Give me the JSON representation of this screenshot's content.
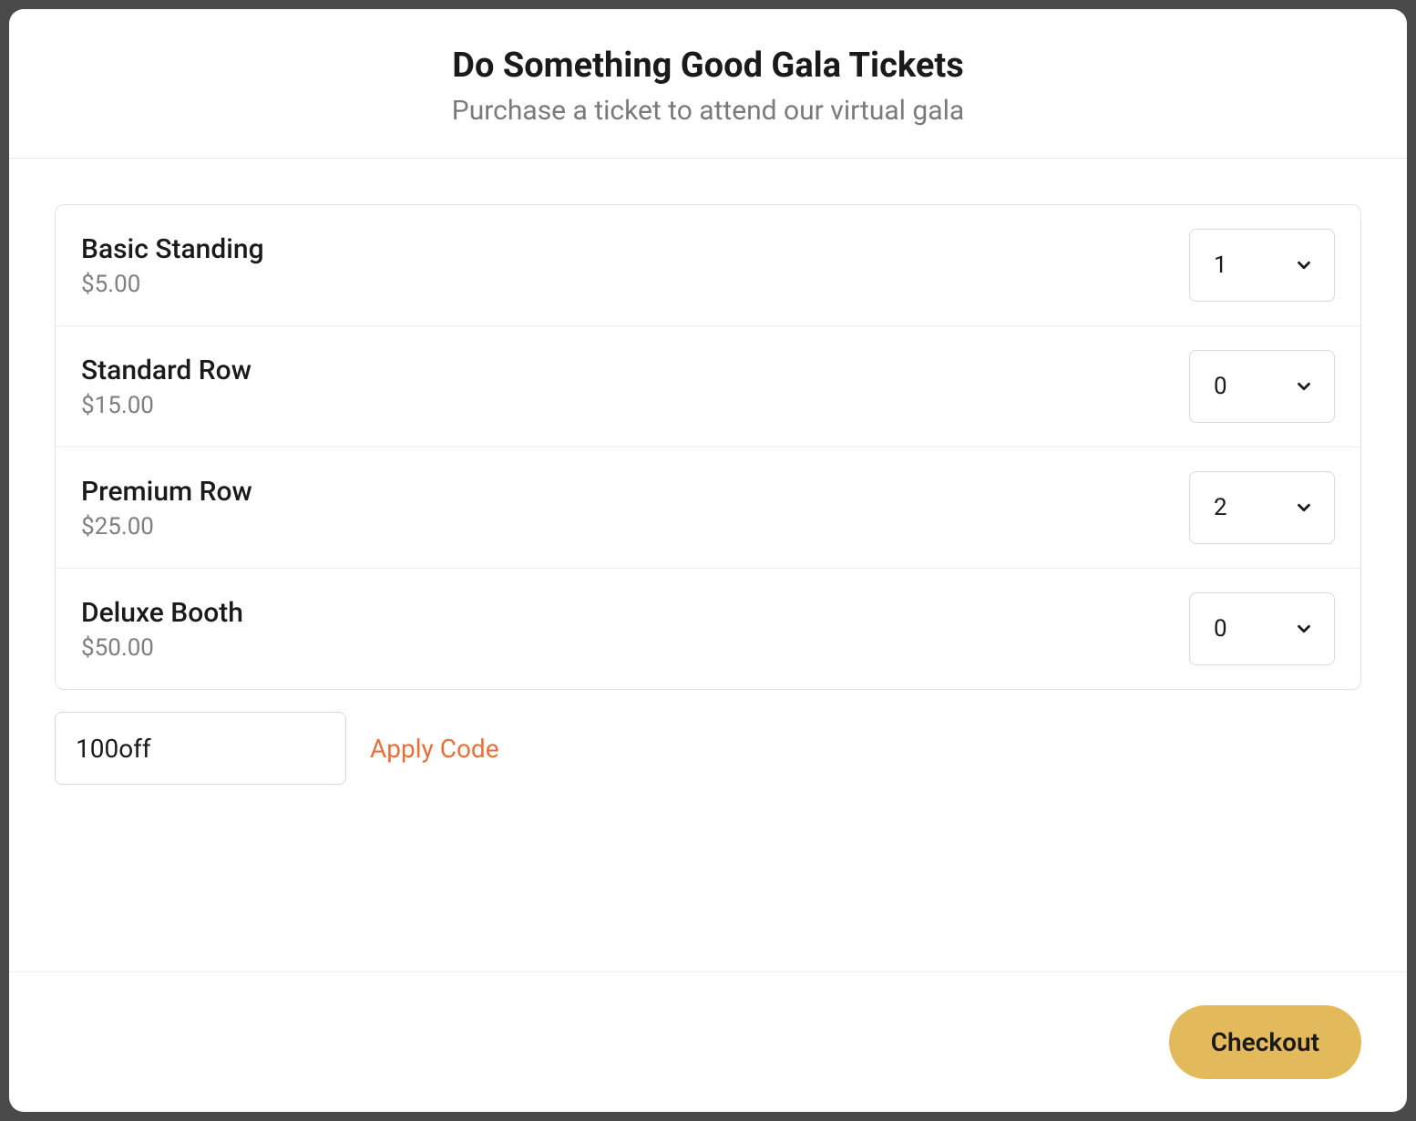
{
  "header": {
    "title": "Do Something Good Gala Tickets",
    "subtitle": "Purchase a ticket to attend our virtual gala"
  },
  "tickets": [
    {
      "name": "Basic Standing",
      "price": "$5.00",
      "quantity": "1"
    },
    {
      "name": "Standard Row",
      "price": "$15.00",
      "quantity": "0"
    },
    {
      "name": "Premium Row",
      "price": "$25.00",
      "quantity": "2"
    },
    {
      "name": "Deluxe Booth",
      "price": "$50.00",
      "quantity": "0"
    }
  ],
  "promo": {
    "value": "100off",
    "apply_label": "Apply Code"
  },
  "footer": {
    "checkout_label": "Checkout"
  }
}
